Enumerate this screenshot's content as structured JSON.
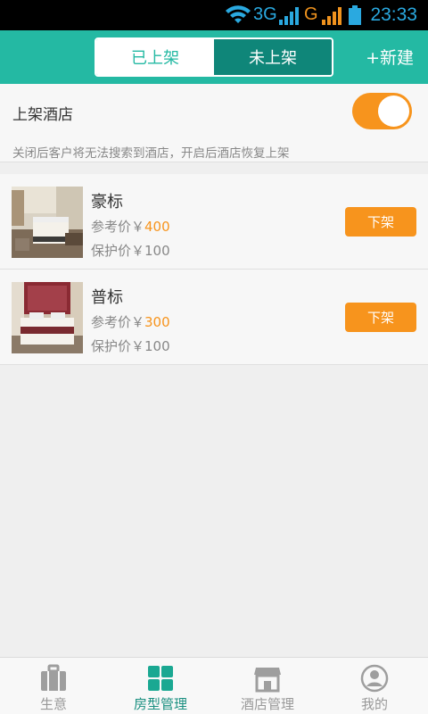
{
  "status_bar": {
    "net1": "3G",
    "net2": "G",
    "time": "23:33"
  },
  "header": {
    "tabs": [
      {
        "label": "已上架",
        "active": true
      },
      {
        "label": "未上架",
        "active": false
      }
    ],
    "add_label": "+新建"
  },
  "hotel_toggle": {
    "title": "上架酒店",
    "enabled": true,
    "description": "关闭后客户将无法搜索到酒店，开启后酒店恢复上架"
  },
  "rooms": [
    {
      "name": "豪标",
      "ref_label": "参考价￥",
      "ref_price": "400",
      "protect_label": "保护价￥100",
      "action": "下架"
    },
    {
      "name": "普标",
      "ref_label": "参考价￥",
      "ref_price": "300",
      "protect_label": "保护价￥100",
      "action": "下架"
    }
  ],
  "bottom_nav": [
    {
      "label": "生意",
      "icon": "briefcase-icon",
      "active": false
    },
    {
      "label": "房型管理",
      "icon": "grid-icon",
      "active": true
    },
    {
      "label": "酒店管理",
      "icon": "store-icon",
      "active": false
    },
    {
      "label": "我的",
      "icon": "user-icon",
      "active": false
    }
  ],
  "colors": {
    "primary": "#24b9a3",
    "dark_tab": "#0f8679",
    "accent": "#f7941d"
  }
}
